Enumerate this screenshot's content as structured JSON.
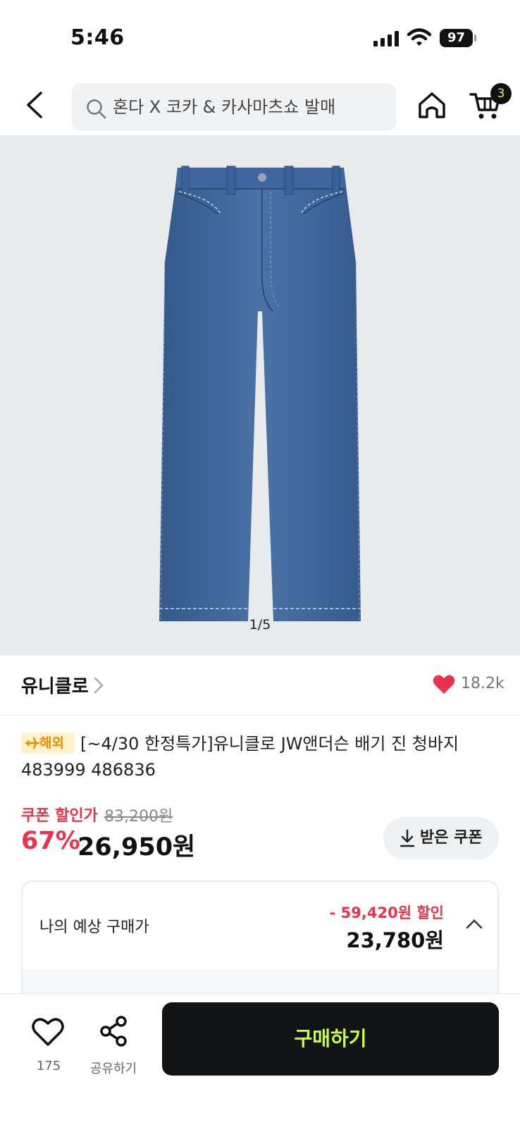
{
  "status_bar": {
    "time": "5:46",
    "battery": "97",
    "icons": [
      "signal-icon",
      "wifi-icon",
      "battery-icon"
    ]
  },
  "header": {
    "search_text": "혼다 X 코카 & 카사마츠쇼 발매",
    "cart_count": "3",
    "icons": [
      "back-arrow-icon",
      "search-icon",
      "home-icon",
      "cart-icon"
    ]
  },
  "gallery": {
    "counter": "1/5"
  },
  "brand": {
    "name": "유니클로",
    "like_count": "18.2k"
  },
  "product": {
    "badge": "해외",
    "title": "[~4/30 한정특가]유니클로 JW앤더슨 배기 진 청바지 483999 486836"
  },
  "price": {
    "coupon_label": "쿠폰 할인가",
    "original_price": "83,200원",
    "discount_rate": "67%",
    "sale_price": "26,950원",
    "coupon_button": "받은 쿠폰"
  },
  "estimate": {
    "label": "나의 예상 구매가",
    "discount": "- 59,420원 할인",
    "price": "23,780원"
  },
  "bottom_bar": {
    "wish_count": "175",
    "share_label": "공유하기",
    "buy_label": "구매하기"
  },
  "colors": {
    "accent_red": "#e8334a",
    "buy_button_bg": "#121314",
    "buy_button_text": "#c8ff3e",
    "overseas_badge_bg": "#fff3cc",
    "overseas_badge_text": "#f08a00"
  }
}
